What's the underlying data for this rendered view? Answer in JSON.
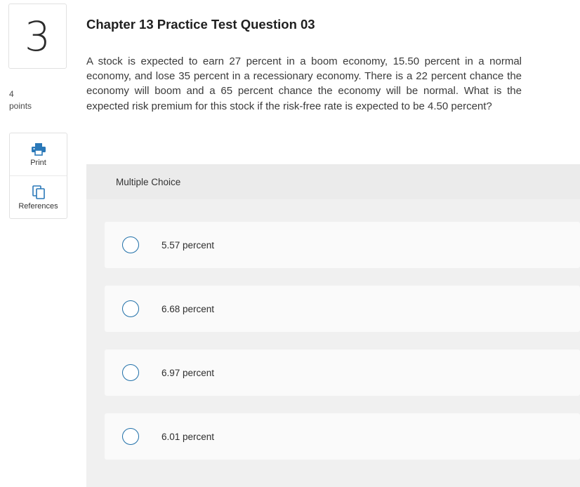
{
  "question_number": "3",
  "points": {
    "value": "4",
    "label": "points"
  },
  "tools": [
    {
      "label": "Print",
      "icon": "print-icon"
    },
    {
      "label": "References",
      "icon": "references-icon"
    }
  ],
  "title": "Chapter 13 Practice Test Question 03",
  "question_text": "A stock is expected to earn 27 percent in a boom economy, 15.50 percent in a normal economy, and lose 35 percent in a recessionary economy. There is a 22 percent chance the economy will boom and a 65 percent chance the economy will be normal. What is the expected risk premium for this stock if the risk-free rate is expected to be 4.50 percent?",
  "multiple_choice": {
    "header": "Multiple Choice",
    "options": [
      {
        "label": "5.57 percent",
        "selected": false
      },
      {
        "label": "6.68 percent",
        "selected": false
      },
      {
        "label": "6.97 percent",
        "selected": false
      },
      {
        "label": "6.01 percent",
        "selected": false
      }
    ]
  },
  "colors": {
    "accent": "#1f6fa8",
    "panel_bg": "#f0f0f0",
    "choice_bg": "#fafafa"
  }
}
